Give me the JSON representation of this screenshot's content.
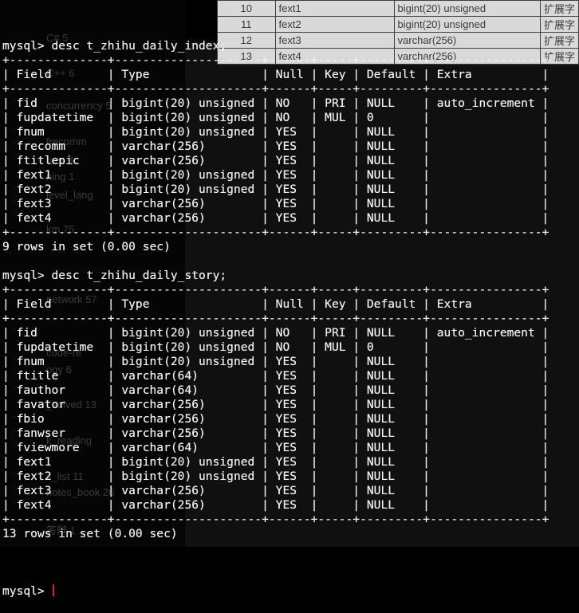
{
  "background": {
    "sidebar_items": [
      "C# 5",
      "C++ 6",
      "concurrency 5",
      "frecomm",
      "face 1",
      "ning 1",
      "level_lang",
      "km 75",
      "network 57",
      "code-re",
      "ogy 6",
      "_solved 13",
      "k_reading",
      "s_list 11",
      "notes_book 26",
      "答辩 1"
    ],
    "spreadsheet_rows": [
      {
        "num": "10",
        "name": "fext1",
        "type": "bigint(20) unsigned",
        "note": "扩展字"
      },
      {
        "num": "11",
        "name": "fext2",
        "type": "bigint(20) unsigned",
        "note": "扩展字"
      },
      {
        "num": "12",
        "name": "fext3",
        "type": "varchar(256)",
        "note": "扩展字"
      },
      {
        "num": "13",
        "name": "fext4",
        "type": "varchar(256)",
        "note": "扩展字"
      }
    ]
  },
  "terminal": {
    "lines": [
      "mysql> desc t_zhihu_daily_index;",
      "+--------------+---------------------+------+-----+---------+----------------+",
      "| Field        | Type                | Null | Key | Default | Extra          |",
      "+--------------+---------------------+------+-----+---------+----------------+",
      "| fid          | bigint(20) unsigned | NO   | PRI | NULL    | auto_increment |",
      "| fupdatetime  | bigint(20) unsigned | NO   | MUL | 0       |                |",
      "| fnum         | bigint(20) unsigned | YES  |     | NULL    |                |",
      "| frecomm      | varchar(256)        | YES  |     | NULL    |                |",
      "| ftitlepic    | varchar(256)        | YES  |     | NULL    |                |",
      "| fext1        | bigint(20) unsigned | YES  |     | NULL    |                |",
      "| fext2        | bigint(20) unsigned | YES  |     | NULL    |                |",
      "| fext3        | varchar(256)        | YES  |     | NULL    |                |",
      "| fext4        | varchar(256)        | YES  |     | NULL    |                |",
      "+--------------+---------------------+------+-----+---------+----------------+",
      "9 rows in set (0.00 sec)",
      "",
      "mysql> desc t_zhihu_daily_story;",
      "+--------------+---------------------+------+-----+---------+----------------+",
      "| Field        | Type                | Null | Key | Default | Extra          |",
      "+--------------+---------------------+------+-----+---------+----------------+",
      "| fid          | bigint(20) unsigned | NO   | PRI | NULL    | auto_increment |",
      "| fupdatetime  | bigint(20) unsigned | NO   | MUL | 0       |                |",
      "| fnum         | bigint(20) unsigned | YES  |     | NULL    |                |",
      "| ftitle       | varchar(64)         | YES  |     | NULL    |                |",
      "| fauthor      | varchar(64)         | YES  |     | NULL    |                |",
      "| favator      | varchar(256)        | YES  |     | NULL    |                |",
      "| fbio         | varchar(256)        | YES  |     | NULL    |                |",
      "| fanwser      | varchar(256)        | YES  |     | NULL    |                |",
      "| fviewmore    | varchar(64)         | YES  |     | NULL    |                |",
      "| fext1        | bigint(20) unsigned | YES  |     | NULL    |                |",
      "| fext2        | bigint(20) unsigned | YES  |     | NULL    |                |",
      "| fext3        | varchar(256)        | YES  |     | NULL    |                |",
      "| fext4        | varchar(256)        | YES  |     | NULL    |                |",
      "+--------------+---------------------+------+-----+---------+----------------+",
      "13 rows in set (0.00 sec)",
      ""
    ],
    "prompt": "mysql> ",
    "input_value": "",
    "cursor_color": "#e02020",
    "text_color": "#f2f2f2",
    "background_color": "#000000"
  }
}
